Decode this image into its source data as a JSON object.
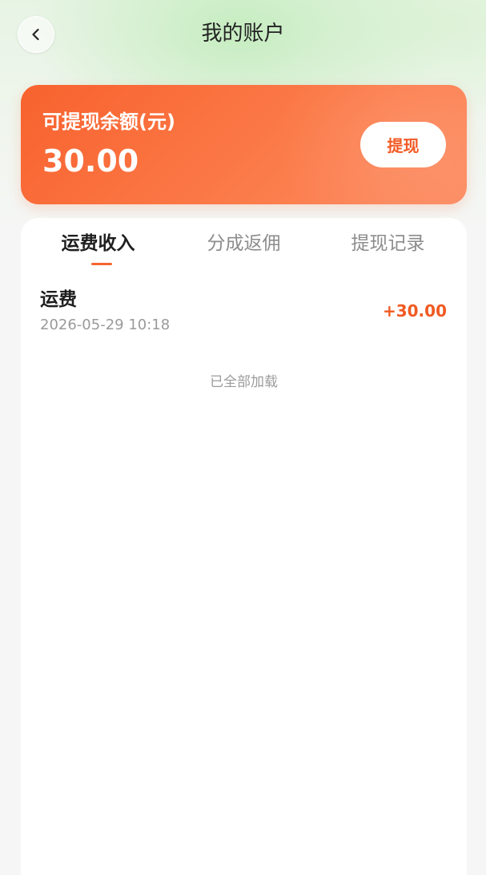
{
  "header": {
    "title": "我的账户",
    "back_icon": "chevron-left-icon"
  },
  "balance_card": {
    "label": "可提现余额(元)",
    "amount": "30.00",
    "withdraw_label": "提现"
  },
  "tabs": [
    {
      "label": "运费收入",
      "active": true
    },
    {
      "label": "分成返佣",
      "active": false
    },
    {
      "label": "提现记录",
      "active": false
    }
  ],
  "records": [
    {
      "title": "运费",
      "time": "2026-05-29 10:18",
      "amount": "+30.00"
    }
  ],
  "end_text": "已全部加载",
  "colors": {
    "accent": "#f4652f",
    "card_start": "#f8622e",
    "card_end": "#fd8d63",
    "amount_text": "#f05a22"
  }
}
